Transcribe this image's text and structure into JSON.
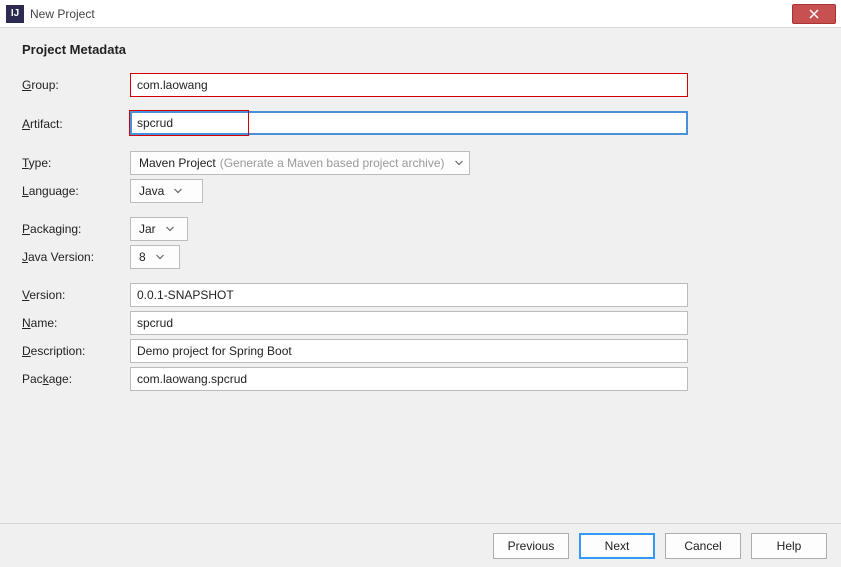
{
  "window": {
    "title": "New Project",
    "app_icon_text": "IJ"
  },
  "section_title": "Project Metadata",
  "labels": {
    "group": "roup:",
    "artifact": "rtifact:",
    "type": "ype:",
    "language": "anguage:",
    "packaging": "ackaging:",
    "java_version": "ava Version:",
    "version": "ersion:",
    "name": "ame:",
    "description": "escription:",
    "package": "ackage:"
  },
  "mnemonics": {
    "group": "G",
    "artifact": "A",
    "type": "T",
    "language": "L",
    "packaging": "P",
    "java_version": "J",
    "version": "V",
    "name": "N",
    "description": "D",
    "package": "P"
  },
  "fields": {
    "group": "com.laowang",
    "artifact": "spcrud",
    "type": "Maven Project",
    "type_hint": "(Generate a Maven based project archive)",
    "language": "Java",
    "packaging": "Jar",
    "java_version": "8",
    "version": "0.0.1-SNAPSHOT",
    "name": "spcrud",
    "description": "Demo project for Spring Boot",
    "package": "com.laowang.spcrud"
  },
  "buttons": {
    "previous": "Previous",
    "next": "Next",
    "cancel": "Cancel",
    "help": "Help"
  }
}
